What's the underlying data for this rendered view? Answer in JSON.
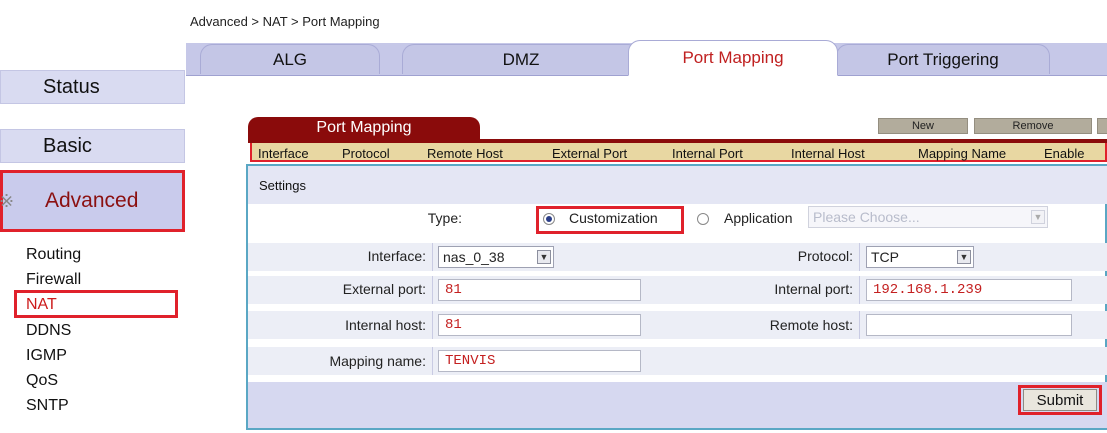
{
  "breadcrumb": "Advanced > NAT > Port Mapping",
  "top_tabs": [
    {
      "label": "ALG"
    },
    {
      "label": "DMZ"
    },
    {
      "label": "Port Mapping"
    },
    {
      "label": "Port Triggering"
    }
  ],
  "sidebar": {
    "status_label": "Status",
    "basic_label": "Basic",
    "advanced_label": "Advanced",
    "sub_items": [
      "Routing",
      "Firewall",
      "NAT",
      "DDNS",
      "IGMP",
      "QoS",
      "SNTP"
    ]
  },
  "port_mapping": {
    "tab_label": "Port Mapping",
    "new_button": "New",
    "remove_button": "Remove",
    "columns": [
      "Interface",
      "Protocol",
      "Remote Host",
      "External Port",
      "Internal Port",
      "Internal Host",
      "Mapping Name",
      "Enable"
    ]
  },
  "settings": {
    "title": "Settings",
    "type_label": "Type:",
    "customization_label": "Customization",
    "application_label": "Application",
    "application_placeholder": "Please Choose...",
    "interface_label": "Interface:",
    "interface_value": "nas_0_38",
    "protocol_label": "Protocol:",
    "protocol_value": "TCP",
    "external_port_label": "External port:",
    "external_port_value": "81",
    "internal_port_label": "Internal port:",
    "internal_port_value": "192.168.1.239",
    "internal_host_label": "Internal host:",
    "internal_host_value": "81",
    "remote_host_label": "Remote host:",
    "remote_host_value": "",
    "mapping_name_label": "Mapping name:",
    "mapping_name_value": "TENVIS",
    "submit_label": "Submit"
  },
  "colors": {
    "highlight_red": "#e0212b",
    "tab_dark_red": "#8a0b0b",
    "nav_lavender": "#c6c8e8",
    "panel_border": "#5aa7c4"
  }
}
